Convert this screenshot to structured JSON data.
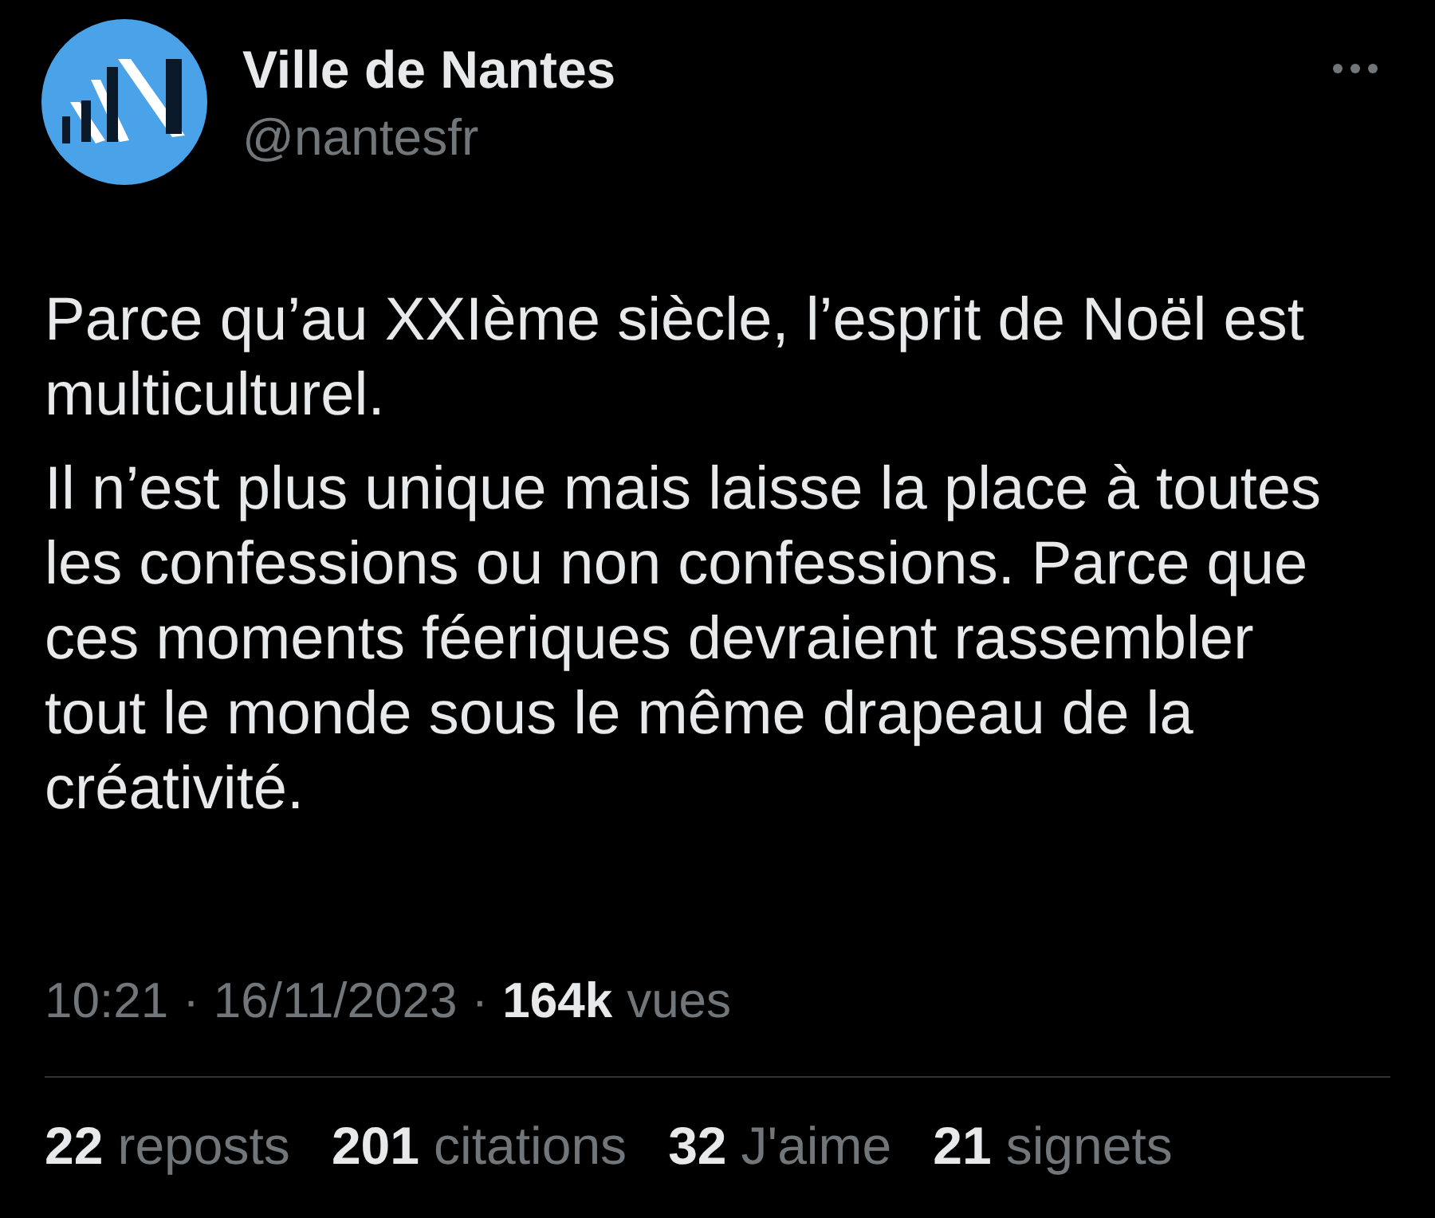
{
  "author": {
    "name": "Ville de Nantes",
    "handle": "@nantesfr"
  },
  "body": [
    "Parce qu’au XXIème siècle, l’esprit de Noël est multiculturel.",
    "Il n’est plus unique mais laisse la place à toutes les confessions ou non confessions. Parce que ces moments féeriques devraient rassembler tout le monde sous le même drapeau de la créativité."
  ],
  "timestamp": {
    "time": "10:21",
    "separator_1": "·",
    "date": "16/11/2023",
    "separator_2": "·",
    "views_count": "164k",
    "views_label": "vues"
  },
  "stats": [
    {
      "count": "22",
      "label": "reposts"
    },
    {
      "count": "201",
      "label": "citations"
    },
    {
      "count": "32",
      "label": "J'aime"
    },
    {
      "count": "21",
      "label": "signets"
    }
  ]
}
